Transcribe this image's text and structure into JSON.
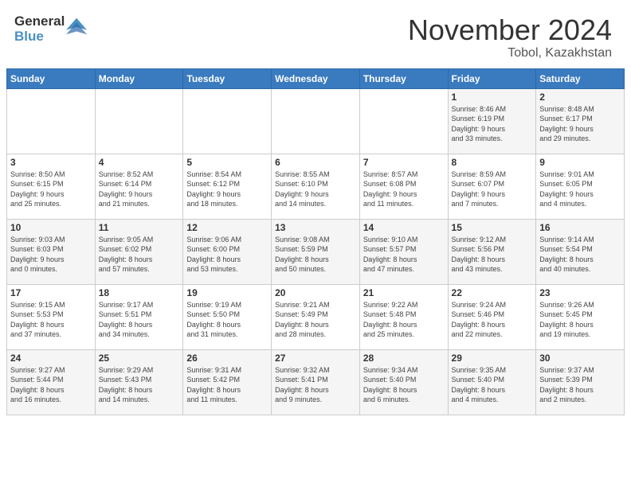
{
  "header": {
    "logo": {
      "general": "General",
      "blue": "Blue"
    },
    "title": "November 2024",
    "location": "Tobol, Kazakhstan"
  },
  "weekdays": [
    "Sunday",
    "Monday",
    "Tuesday",
    "Wednesday",
    "Thursday",
    "Friday",
    "Saturday"
  ],
  "weeks": [
    [
      {
        "day": "",
        "info": ""
      },
      {
        "day": "",
        "info": ""
      },
      {
        "day": "",
        "info": ""
      },
      {
        "day": "",
        "info": ""
      },
      {
        "day": "",
        "info": ""
      },
      {
        "day": "1",
        "info": "Sunrise: 8:46 AM\nSunset: 6:19 PM\nDaylight: 9 hours\nand 33 minutes."
      },
      {
        "day": "2",
        "info": "Sunrise: 8:48 AM\nSunset: 6:17 PM\nDaylight: 9 hours\nand 29 minutes."
      }
    ],
    [
      {
        "day": "3",
        "info": "Sunrise: 8:50 AM\nSunset: 6:15 PM\nDaylight: 9 hours\nand 25 minutes."
      },
      {
        "day": "4",
        "info": "Sunrise: 8:52 AM\nSunset: 6:14 PM\nDaylight: 9 hours\nand 21 minutes."
      },
      {
        "day": "5",
        "info": "Sunrise: 8:54 AM\nSunset: 6:12 PM\nDaylight: 9 hours\nand 18 minutes."
      },
      {
        "day": "6",
        "info": "Sunrise: 8:55 AM\nSunset: 6:10 PM\nDaylight: 9 hours\nand 14 minutes."
      },
      {
        "day": "7",
        "info": "Sunrise: 8:57 AM\nSunset: 6:08 PM\nDaylight: 9 hours\nand 11 minutes."
      },
      {
        "day": "8",
        "info": "Sunrise: 8:59 AM\nSunset: 6:07 PM\nDaylight: 9 hours\nand 7 minutes."
      },
      {
        "day": "9",
        "info": "Sunrise: 9:01 AM\nSunset: 6:05 PM\nDaylight: 9 hours\nand 4 minutes."
      }
    ],
    [
      {
        "day": "10",
        "info": "Sunrise: 9:03 AM\nSunset: 6:03 PM\nDaylight: 9 hours\nand 0 minutes."
      },
      {
        "day": "11",
        "info": "Sunrise: 9:05 AM\nSunset: 6:02 PM\nDaylight: 8 hours\nand 57 minutes."
      },
      {
        "day": "12",
        "info": "Sunrise: 9:06 AM\nSunset: 6:00 PM\nDaylight: 8 hours\nand 53 minutes."
      },
      {
        "day": "13",
        "info": "Sunrise: 9:08 AM\nSunset: 5:59 PM\nDaylight: 8 hours\nand 50 minutes."
      },
      {
        "day": "14",
        "info": "Sunrise: 9:10 AM\nSunset: 5:57 PM\nDaylight: 8 hours\nand 47 minutes."
      },
      {
        "day": "15",
        "info": "Sunrise: 9:12 AM\nSunset: 5:56 PM\nDaylight: 8 hours\nand 43 minutes."
      },
      {
        "day": "16",
        "info": "Sunrise: 9:14 AM\nSunset: 5:54 PM\nDaylight: 8 hours\nand 40 minutes."
      }
    ],
    [
      {
        "day": "17",
        "info": "Sunrise: 9:15 AM\nSunset: 5:53 PM\nDaylight: 8 hours\nand 37 minutes."
      },
      {
        "day": "18",
        "info": "Sunrise: 9:17 AM\nSunset: 5:51 PM\nDaylight: 8 hours\nand 34 minutes."
      },
      {
        "day": "19",
        "info": "Sunrise: 9:19 AM\nSunset: 5:50 PM\nDaylight: 8 hours\nand 31 minutes."
      },
      {
        "day": "20",
        "info": "Sunrise: 9:21 AM\nSunset: 5:49 PM\nDaylight: 8 hours\nand 28 minutes."
      },
      {
        "day": "21",
        "info": "Sunrise: 9:22 AM\nSunset: 5:48 PM\nDaylight: 8 hours\nand 25 minutes."
      },
      {
        "day": "22",
        "info": "Sunrise: 9:24 AM\nSunset: 5:46 PM\nDaylight: 8 hours\nand 22 minutes."
      },
      {
        "day": "23",
        "info": "Sunrise: 9:26 AM\nSunset: 5:45 PM\nDaylight: 8 hours\nand 19 minutes."
      }
    ],
    [
      {
        "day": "24",
        "info": "Sunrise: 9:27 AM\nSunset: 5:44 PM\nDaylight: 8 hours\nand 16 minutes."
      },
      {
        "day": "25",
        "info": "Sunrise: 9:29 AM\nSunset: 5:43 PM\nDaylight: 8 hours\nand 14 minutes."
      },
      {
        "day": "26",
        "info": "Sunrise: 9:31 AM\nSunset: 5:42 PM\nDaylight: 8 hours\nand 11 minutes."
      },
      {
        "day": "27",
        "info": "Sunrise: 9:32 AM\nSunset: 5:41 PM\nDaylight: 8 hours\nand 9 minutes."
      },
      {
        "day": "28",
        "info": "Sunrise: 9:34 AM\nSunset: 5:40 PM\nDaylight: 8 hours\nand 6 minutes."
      },
      {
        "day": "29",
        "info": "Sunrise: 9:35 AM\nSunset: 5:40 PM\nDaylight: 8 hours\nand 4 minutes."
      },
      {
        "day": "30",
        "info": "Sunrise: 9:37 AM\nSunset: 5:39 PM\nDaylight: 8 hours\nand 2 minutes."
      }
    ]
  ]
}
